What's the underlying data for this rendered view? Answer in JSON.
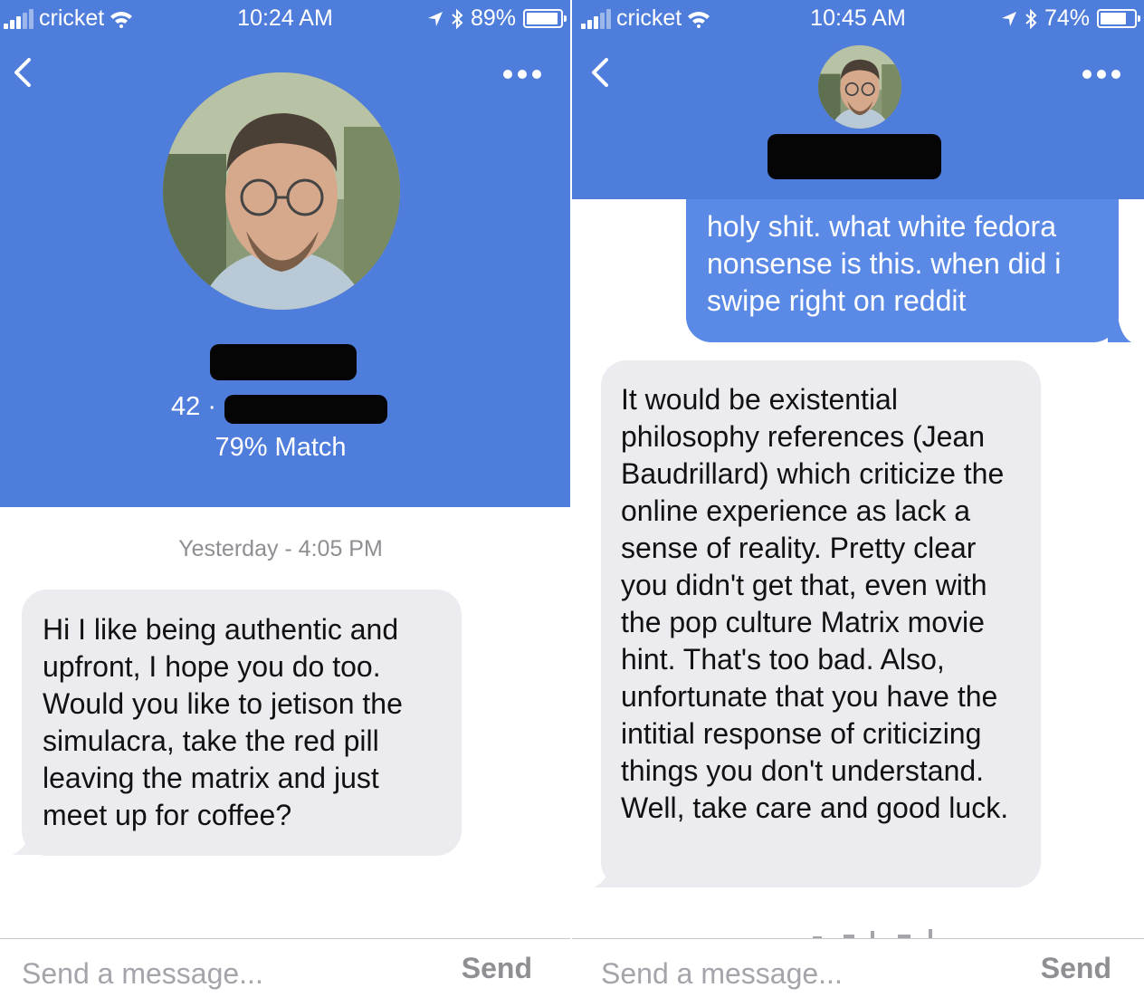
{
  "colors": {
    "header_blue": "#4f7ddb",
    "sent_bubble": "#5b8ae6",
    "received_bubble": "#ebebf0"
  },
  "left": {
    "status": {
      "carrier": "cricket",
      "time": "10:24 AM",
      "battery": "89%",
      "battery_level": 0.89
    },
    "profile": {
      "age": "42 ·",
      "match": "79% Match",
      "name_redacted": true,
      "location_redacted": true
    },
    "conversation": {
      "timestamp": "Yesterday - 4:05 PM",
      "received_message": "Hi I like being authentic and upfront, I hope you do too. Would you like to jetison the simulacra, take the red pill leaving the matrix and just meet up for coffee?"
    },
    "composer": {
      "placeholder": "Send a message...",
      "send_label": "Send"
    }
  },
  "right": {
    "status": {
      "carrier": "cricket",
      "time": "10:45 AM",
      "battery": "74%",
      "battery_level": 0.74
    },
    "profile": {
      "name_redacted": true
    },
    "conversation": {
      "sent_message": "holy shit. what white fedora nonsense is this. when did i swipe right on reddit",
      "received_message": "It would be existential philosophy references (Jean Baudrillard) which criticize the online experience as lack a sense of reality. Pretty clear you didn't get that, even with the pop culture Matrix movie hint. That's too bad. Also, unfortunate that you have the intitial response of criticizing things you don't understand. Well, take care and good luck."
    },
    "composer": {
      "placeholder": "Send a message...",
      "send_label": "Send"
    }
  },
  "icons": {
    "back": "chevron-left-icon",
    "more": "ellipsis-icon",
    "wifi": "wifi-icon",
    "location": "location-arrow-icon",
    "bluetooth": "bluetooth-icon",
    "battery": "battery-icon",
    "signal": "signal-bars-icon"
  }
}
